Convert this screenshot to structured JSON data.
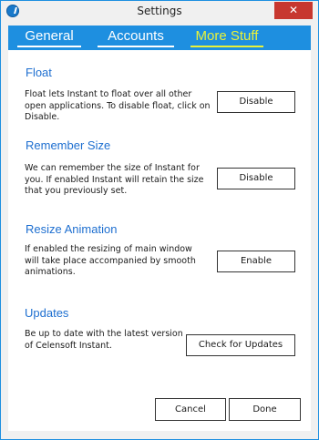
{
  "window": {
    "title": "Settings",
    "close_glyph": "✕",
    "app_icon": "celensoft-instant-icon"
  },
  "tabs": [
    {
      "label": "General",
      "active": false
    },
    {
      "label": "Accounts",
      "active": false
    },
    {
      "label": "More Stuff",
      "active": true
    }
  ],
  "sections": {
    "float": {
      "title": "Float",
      "description": "Float lets Instant to float over all other open applications. To disable float, click on Disable.",
      "button": "Disable"
    },
    "remember_size": {
      "title": "Remember Size",
      "description": "We can remember the size of Instant for you. If enabled Instant will retain the size that you previously set.",
      "button": "Disable"
    },
    "resize_animation": {
      "title": "Resize Animation",
      "description": "If enabled the resizing of main window will take place accompanied by smooth animations.",
      "button": "Enable"
    },
    "updates": {
      "title": "Updates",
      "description": "Be up to date with the latest version of Celensoft Instant.",
      "button": "Check for Updates"
    }
  },
  "footer": {
    "cancel": "Cancel",
    "done": "Done"
  },
  "colors": {
    "accent": "#1e8fe0",
    "active_tab": "#e9f23a",
    "section_title": "#1e6fd0",
    "close": "#c7372f"
  }
}
